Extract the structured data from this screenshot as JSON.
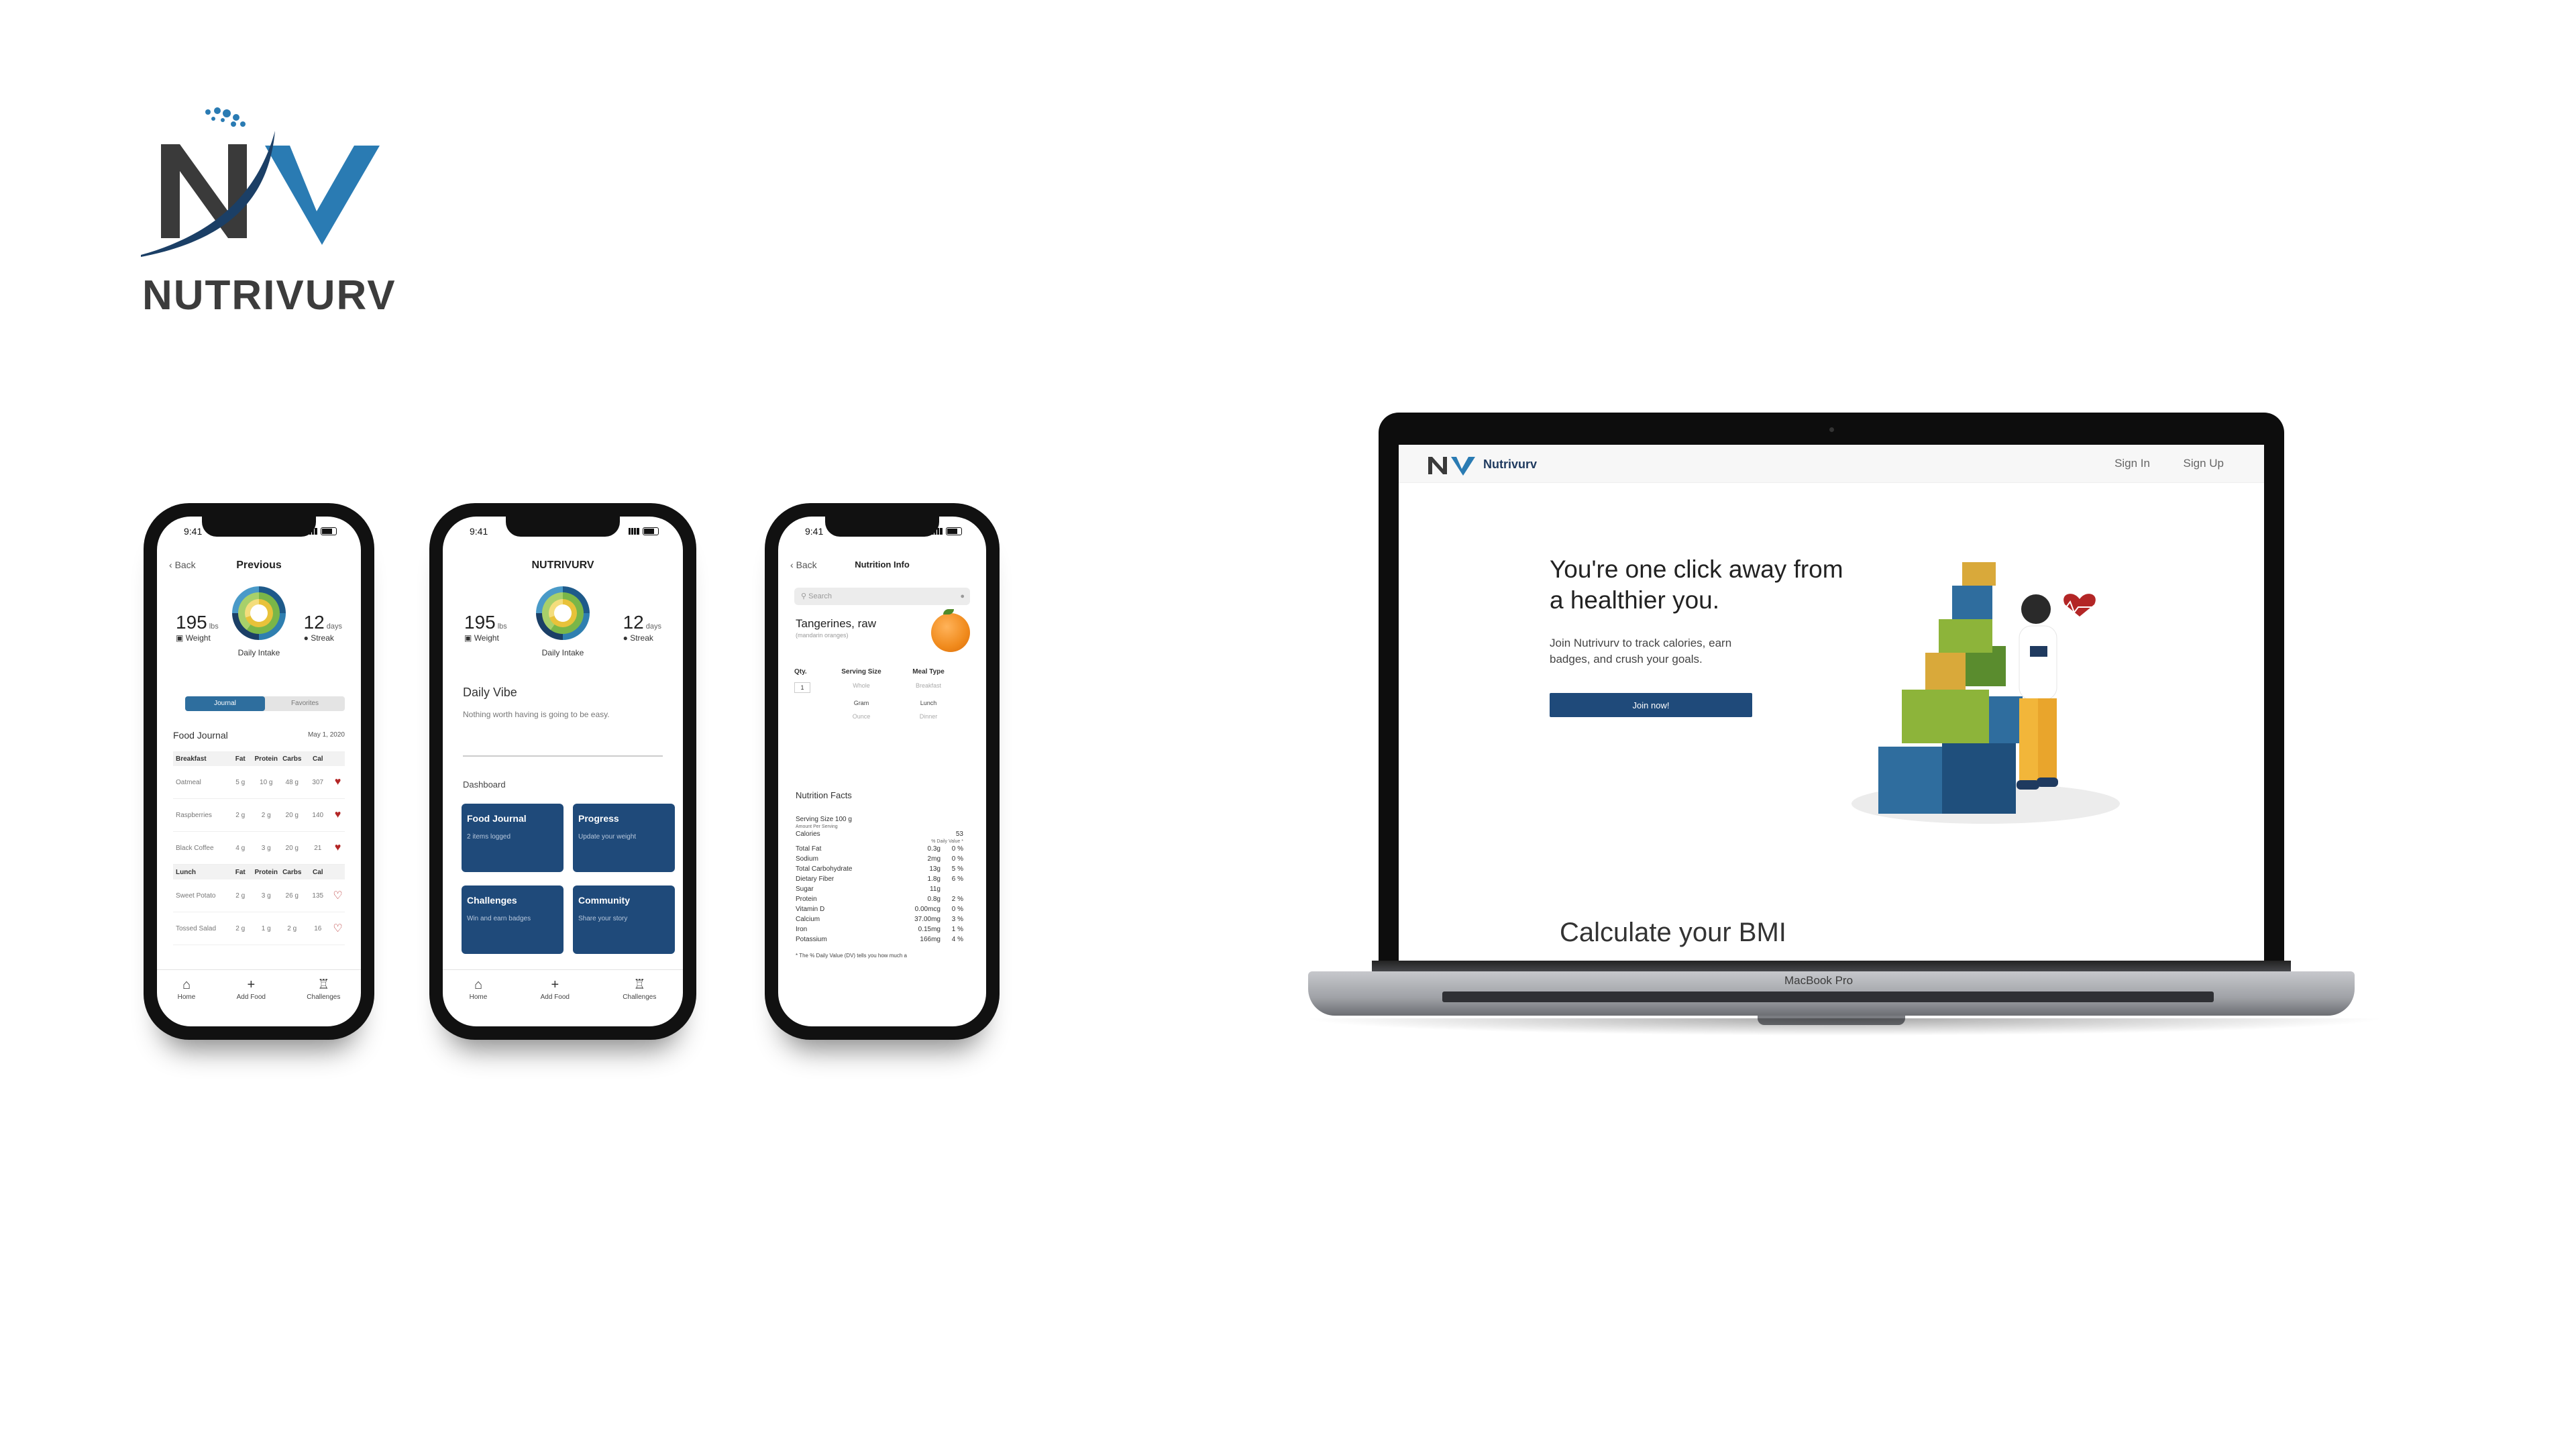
{
  "brand": {
    "name": "NUTRIVURV",
    "logo_letters": "NV"
  },
  "phone1": {
    "time": "9:41",
    "back": "Back",
    "title": "Previous",
    "weight": {
      "value": "195",
      "unit": "lbs",
      "label": "Weight"
    },
    "intake_label": "Daily Intake",
    "streak": {
      "value": "12",
      "unit": "days",
      "label": "Streak"
    },
    "segment": [
      "Journal",
      "Favorites"
    ],
    "food_journal": "Food Journal",
    "date": "May 1, 2020",
    "columns": [
      "Fat",
      "Protein",
      "Carbs",
      "Cal"
    ],
    "breakfast_label": "Breakfast",
    "breakfast": [
      {
        "name": "Oatmeal",
        "fat": "5 g",
        "protein": "10 g",
        "carbs": "48 g",
        "cal": "307",
        "fav": true
      },
      {
        "name": "Raspberries",
        "fat": "2 g",
        "protein": "2 g",
        "carbs": "20 g",
        "cal": "140",
        "fav": true
      },
      {
        "name": "Black Coffee",
        "fat": "4 g",
        "protein": "3 g",
        "carbs": "20 g",
        "cal": "21",
        "fav": true
      }
    ],
    "lunch_label": "Lunch",
    "lunch": [
      {
        "name": "Sweet Potato",
        "fat": "2 g",
        "protein": "3 g",
        "carbs": "26 g",
        "cal": "135",
        "fav": false
      },
      {
        "name": "Tossed Salad",
        "fat": "2 g",
        "protein": "1 g",
        "carbs": "2 g",
        "cal": "16",
        "fav": false
      }
    ],
    "tabs": [
      "Home",
      "Add Food",
      "Challenges"
    ]
  },
  "phone2": {
    "time": "9:41",
    "title": "NUTRIVURV",
    "weight": {
      "value": "195",
      "unit": "lbs",
      "label": "Weight"
    },
    "intake_label": "Daily Intake",
    "streak": {
      "value": "12",
      "unit": "days",
      "label": "Streak"
    },
    "vibe_title": "Daily Vibe",
    "vibe_text": "Nothing worth having is going to be easy.",
    "dashboard": "Dashboard",
    "cards": [
      {
        "title": "Food Journal",
        "sub": "2 items logged"
      },
      {
        "title": "Progress",
        "sub": "Update your weight"
      },
      {
        "title": "Challenges",
        "sub": "Win and earn badges"
      },
      {
        "title": "Community",
        "sub": "Share your story"
      }
    ],
    "tabs": [
      "Home",
      "Add Food",
      "Challenges"
    ]
  },
  "phone3": {
    "time": "9:41",
    "back": "Back",
    "title": "Nutrition Info",
    "search_placeholder": "Search",
    "food": "Tangerines, raw",
    "food_sub": "(mandarin oranges)",
    "opt_headers": [
      "Qty.",
      "Serving Size",
      "Meal Type"
    ],
    "qty": "1",
    "serving_options": [
      "Whole",
      "Gram",
      "Ounce"
    ],
    "meal_options": [
      "Breakfast",
      "Lunch",
      "Dinner"
    ],
    "nf_title": "Nutrition Facts",
    "serving_size": "Serving Size 100 g",
    "amount_per": "Amount Per Serving",
    "calories_label": "Calories",
    "calories": "53",
    "dv_label": "% Daily Value *",
    "nutrients": [
      {
        "name": "Total Fat",
        "amount": "0.3g",
        "dv": "0 %"
      },
      {
        "name": "Sodium",
        "amount": "2mg",
        "dv": "0 %"
      },
      {
        "name": "Total Carbohydrate",
        "amount": "13g",
        "dv": "5 %"
      },
      {
        "name": "Dietary Fiber",
        "amount": "1.8g",
        "dv": "6 %"
      },
      {
        "name": "Sugar",
        "amount": "11g",
        "dv": ""
      },
      {
        "name": "Protein",
        "amount": "0.8g",
        "dv": "2 %"
      },
      {
        "name": "Vitamin D",
        "amount": "0.00mcg",
        "dv": "0 %"
      },
      {
        "name": "Calcium",
        "amount": "37.00mg",
        "dv": "3 %"
      },
      {
        "name": "Iron",
        "amount": "0.15mg",
        "dv": "1 %"
      },
      {
        "name": "Potassium",
        "amount": "166mg",
        "dv": "4 %"
      }
    ],
    "note": "* The % Daily Value (DV) tells you how much a"
  },
  "website": {
    "brand": "Nutrivurv",
    "sign_in": "Sign In",
    "sign_up": "Sign Up",
    "hero_title": "You're one click away from a healthier you.",
    "hero_text": "Join Nutrivurv to track calories, earn badges, and crush your goals.",
    "join_button": "Join now!",
    "bmi_heading": "Calculate your BMI"
  },
  "laptop": {
    "label": "MacBook Pro"
  },
  "colors": {
    "navy": "#1f4a7a",
    "logo_dark": "#3a3a3a",
    "logo_blue": "#2a7bb3",
    "heart": "#b32626"
  }
}
